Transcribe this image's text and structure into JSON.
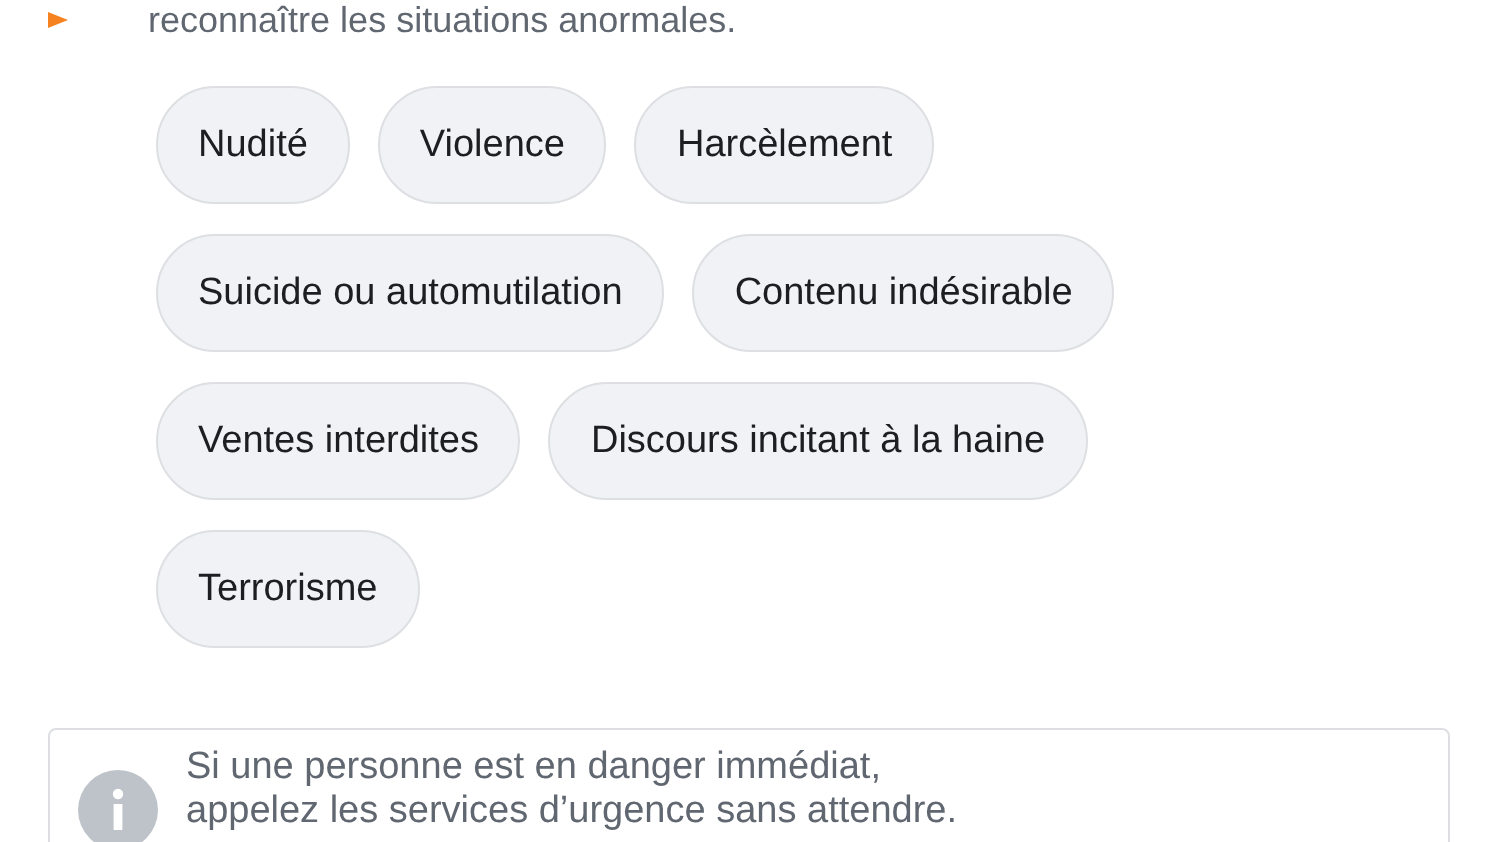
{
  "intro": {
    "text": "reconnaître les situations anormales."
  },
  "tags": [
    {
      "label": "Nudité"
    },
    {
      "label": "Violence"
    },
    {
      "label": "Harcèlement"
    },
    {
      "label": "Suicide ou automutilation"
    },
    {
      "label": "Contenu indésirable"
    },
    {
      "label": "Ventes interdites"
    },
    {
      "label": "Discours incitant à la haine"
    },
    {
      "label": "Terrorisme"
    }
  ],
  "notice": {
    "lines": [
      "Si une personne est en danger immédiat,",
      "appelez les services d’urgence sans attendre."
    ]
  }
}
